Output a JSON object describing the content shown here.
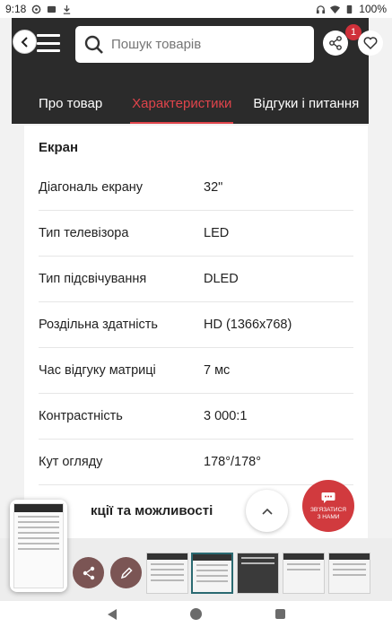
{
  "status_bar": {
    "time": "9:18",
    "battery": "100%"
  },
  "header": {
    "search_placeholder": "Пошук товарів",
    "cart_count": "1",
    "tabs": [
      {
        "label": "Про товар"
      },
      {
        "label": "Характеристики",
        "active": true
      },
      {
        "label": "Відгуки і питання"
      }
    ]
  },
  "specs": {
    "section_title": "Екран",
    "rows": [
      {
        "key": "Діагональ екрану",
        "value": "32\""
      },
      {
        "key": "Тип телевізора",
        "value": "LED"
      },
      {
        "key": "Тип підсвічування",
        "value": "DLED"
      },
      {
        "key": "Роздільна здатність",
        "value": "HD (1366x768)"
      },
      {
        "key": "Час відгуку матриці",
        "value": "7 мс"
      },
      {
        "key": "Контрастність",
        "value": "3 000:1"
      },
      {
        "key": "Кут огляду",
        "value": "178°/178°"
      }
    ],
    "next_section_title": "кції та можливості"
  },
  "contact": {
    "line1": "ЗВ'ЯЗАТИСЯ",
    "line2": "З НАМИ"
  },
  "colors": {
    "accent": "#e0444b",
    "header_bg": "#2b2b2b",
    "contact_bg": "#d13a3e"
  }
}
